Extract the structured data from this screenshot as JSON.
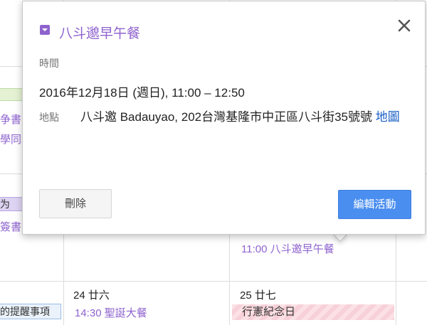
{
  "popup": {
    "title": "八斗邈早午餐",
    "time_label": "時間",
    "time_value": "2016年12月18日 (週日), 11:00 – 12:50",
    "location_label": "地點",
    "location_value": "八斗邀 Badauyao, 202台灣基隆市中正區八斗街35號號",
    "map_link": "地圖",
    "delete_button": "刪除",
    "edit_button": "編輯活動",
    "event_color": "#8e63ce"
  },
  "calendar": {
    "left_col": {
      "frag_1": "争書",
      "frag_2": "學同心",
      "frag_3": "为",
      "frag_4": "簽書",
      "reminder_chip": "的提醒事項"
    },
    "mid_col": {
      "day_label": "24 廿六",
      "event_text": "14:30 聖誕大餐"
    },
    "right_col": {
      "event_text": "11:00 八斗邀早午餐",
      "day_label": "25 廿七",
      "holiday_chip": "行憲紀念日"
    }
  }
}
